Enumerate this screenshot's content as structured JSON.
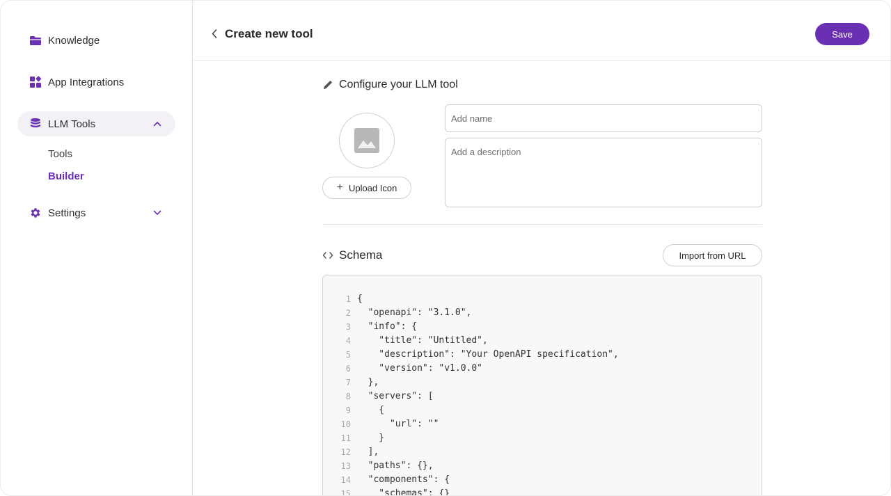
{
  "sidebar": {
    "items": [
      {
        "label": "Knowledge",
        "icon": "folder-icon"
      },
      {
        "label": "App Integrations",
        "icon": "widgets-icon"
      },
      {
        "label": "LLM Tools",
        "icon": "database-icon",
        "expanded": true
      },
      {
        "label": "Settings",
        "icon": "gear-icon",
        "expanded": false
      }
    ],
    "sub_items": [
      {
        "label": "Tools",
        "active": false
      },
      {
        "label": "Builder",
        "active": true
      }
    ]
  },
  "header": {
    "title": "Create new tool",
    "save_label": "Save"
  },
  "configure": {
    "title": "Configure your LLM tool",
    "upload_label": "Upload Icon",
    "name_placeholder": "Add name",
    "description_placeholder": "Add a description"
  },
  "schema": {
    "title": "Schema",
    "import_label": "Import from URL",
    "code_lines": [
      {
        "n": "1",
        "text": "{"
      },
      {
        "n": "2",
        "text": "  \"openapi\": \"3.1.0\","
      },
      {
        "n": "3",
        "text": "  \"info\": {"
      },
      {
        "n": "4",
        "text": "    \"title\": \"Untitled\","
      },
      {
        "n": "5",
        "text": "    \"description\": \"Your OpenAPI specification\","
      },
      {
        "n": "6",
        "text": "    \"version\": \"v1.0.0\""
      },
      {
        "n": "7",
        "text": "  },"
      },
      {
        "n": "8",
        "text": "  \"servers\": ["
      },
      {
        "n": "9",
        "text": "    {"
      },
      {
        "n": "10",
        "text": "      \"url\": \"\""
      },
      {
        "n": "11",
        "text": "    }"
      },
      {
        "n": "12",
        "text": "  ],"
      },
      {
        "n": "13",
        "text": "  \"paths\": {},"
      },
      {
        "n": "14",
        "text": "  \"components\": {"
      },
      {
        "n": "15",
        "text": "    \"schemas\": {}"
      }
    ]
  },
  "colors": {
    "accent": "#6b2fb3",
    "active_bg": "#f3f1f6"
  }
}
